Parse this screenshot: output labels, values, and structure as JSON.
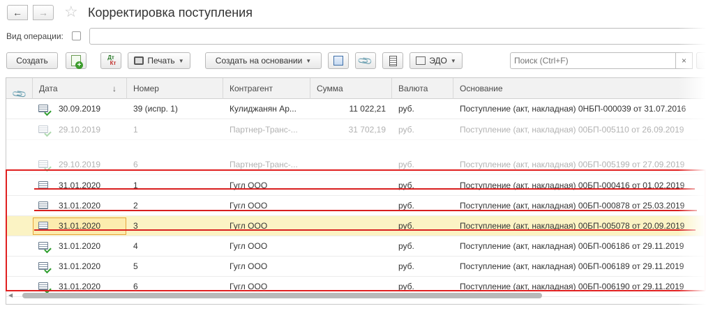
{
  "window": {
    "title": "Корректировка поступления"
  },
  "filter": {
    "operation_type_label": "Вид операции:"
  },
  "toolbar": {
    "create_label": "Создать",
    "print_label": "Печать",
    "create_based_on_label": "Создать на основании",
    "edo_label": "ЭДО",
    "dt_label": "Дт",
    "kt_label": "Кт"
  },
  "search": {
    "placeholder": "Поиск (Ctrl+F)",
    "clear_glyph": "×"
  },
  "table": {
    "columns": [
      "Дата",
      "Номер",
      "Контрагент",
      "Сумма",
      "Валюта",
      "Основание"
    ],
    "rows": [
      {
        "date": "30.09.2019",
        "number": "39 (испр. 1)",
        "counterparty": "Кулиджанян Ар...",
        "amount": "11 022,21",
        "currency": "руб.",
        "basis": "Поступление (акт, накладная) 0НБП-000039 от 31.07.2016",
        "posted": true,
        "faded": false,
        "selected": false
      },
      {
        "date": "29.10.2019",
        "number": "1",
        "counterparty": "Партнер-Транс-...",
        "amount": "31 702,19",
        "currency": "руб.",
        "basis": "Поступление (акт, накладная) 00БП-005110 от 26.09.2019",
        "posted": true,
        "faded": true,
        "selected": false
      },
      {
        "date": "29.10.2019",
        "number": "6",
        "counterparty": "Партнер-Транс-...",
        "amount": "",
        "currency": "руб.",
        "basis": "Поступление (акт, накладная) 00БП-005199 от 27.09.2019",
        "posted": true,
        "faded": true,
        "selected": false
      },
      {
        "date": "31.01.2020",
        "number": "1",
        "counterparty": "Гугл ООО",
        "amount": "",
        "currency": "руб.",
        "basis": "Поступление (акт, накладная) 00БП-000416 от 01.02.2019",
        "posted": false,
        "faded": false,
        "selected": false
      },
      {
        "date": "31.01.2020",
        "number": "2",
        "counterparty": "Гугл ООО",
        "amount": "",
        "currency": "руб.",
        "basis": "Поступление (акт, накладная) 00БП-000878 от 25.03.2019",
        "posted": false,
        "faded": false,
        "selected": false
      },
      {
        "date": "31.01.2020",
        "number": "3",
        "counterparty": "Гугл ООО",
        "amount": "",
        "currency": "руб.",
        "basis": "Поступление (акт, накладная) 00БП-005078 от 20.09.2019",
        "posted": false,
        "faded": false,
        "selected": true
      },
      {
        "date": "31.01.2020",
        "number": "4",
        "counterparty": "Гугл ООО",
        "amount": "",
        "currency": "руб.",
        "basis": "Поступление (акт, накладная) 00БП-006186 от 29.11.2019",
        "posted": true,
        "faded": false,
        "selected": false
      },
      {
        "date": "31.01.2020",
        "number": "5",
        "counterparty": "Гугл ООО",
        "amount": "",
        "currency": "руб.",
        "basis": "Поступление (акт, накладная) 00БП-006189 от 29.11.2019",
        "posted": true,
        "faded": false,
        "selected": false
      },
      {
        "date": "31.01.2020",
        "number": "6",
        "counterparty": "Гугл ООО",
        "amount": "",
        "currency": "руб.",
        "basis": "Поступление (акт, накладная) 00БП-006190 от 29.11.2019",
        "posted": true,
        "faded": false,
        "selected": false
      }
    ]
  },
  "colors": {
    "highlight_red": "#e02020",
    "selected_row": "#fbf3c4",
    "active_cell": "#fcecae",
    "posted_check": "#2e9e2e"
  },
  "icons": [
    "back-arrow-icon",
    "forward-arrow-icon",
    "favorite-star-icon",
    "create-copy-icon",
    "dt-kt-icon",
    "printer-icon",
    "structure-icon",
    "attachment-icon",
    "list-icon",
    "edo-icon",
    "sort-descending-icon",
    "document-icon",
    "document-posted-icon"
  ]
}
